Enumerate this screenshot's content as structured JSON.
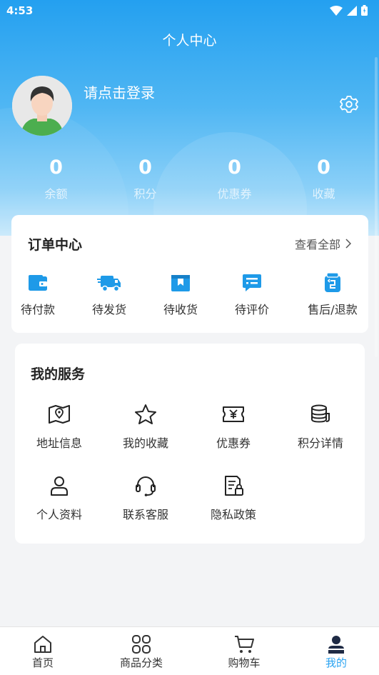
{
  "status_bar": {
    "time": "4:53"
  },
  "header": {
    "title": "个人中心"
  },
  "profile": {
    "login_text": "请点击登录"
  },
  "stats": [
    {
      "value": "0",
      "label": "余额"
    },
    {
      "value": "0",
      "label": "积分"
    },
    {
      "value": "0",
      "label": "优惠券"
    },
    {
      "value": "0",
      "label": "收藏"
    }
  ],
  "orders": {
    "title": "订单中心",
    "view_all": "查看全部",
    "items": [
      {
        "label": "待付款",
        "icon": "wallet-icon"
      },
      {
        "label": "待发货",
        "icon": "truck-icon"
      },
      {
        "label": "待收货",
        "icon": "box-icon"
      },
      {
        "label": "待评价",
        "icon": "comment-icon"
      },
      {
        "label": "售后/退款",
        "icon": "refund-icon"
      }
    ]
  },
  "services": {
    "title": "我的服务",
    "items": [
      {
        "label": "地址信息",
        "icon": "map-icon"
      },
      {
        "label": "我的收藏",
        "icon": "star-icon"
      },
      {
        "label": "优惠券",
        "icon": "coupon-icon"
      },
      {
        "label": "积分详情",
        "icon": "coins-icon"
      },
      {
        "label": "个人资料",
        "icon": "user-icon"
      },
      {
        "label": "联系客服",
        "icon": "headset-icon"
      },
      {
        "label": "隐私政策",
        "icon": "privacy-document-icon"
      }
    ]
  },
  "bottom_nav": [
    {
      "label": "首页",
      "icon": "home-icon"
    },
    {
      "label": "商品分类",
      "icon": "category-icon"
    },
    {
      "label": "购物车",
      "icon": "cart-icon"
    },
    {
      "label": "我的",
      "icon": "profile-icon",
      "active": true
    }
  ],
  "colors": {
    "primary": "#2aa3f1",
    "order_icon": "#1e9ae8",
    "text": "#333333"
  }
}
